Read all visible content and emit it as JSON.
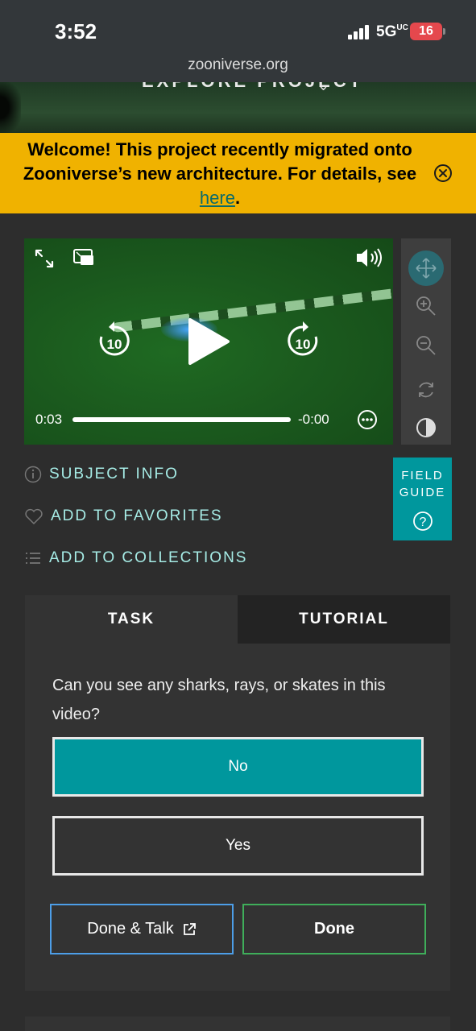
{
  "status_bar": {
    "time": "3:52",
    "network": "5G",
    "network_suffix": "UC",
    "battery": "16"
  },
  "browser": {
    "url": "zooniverse.org"
  },
  "hero": {
    "explore_label": "EXPLORE PROJECT"
  },
  "banner": {
    "text_before_link": "Welcome! This project recently migrated onto Zooniverse’s new architecture. For details, see ",
    "link_text": "here",
    "text_after_link": ".",
    "close_icon": "close-circle-icon"
  },
  "video": {
    "current_time": "0:03",
    "remaining_time": "-0:00",
    "skip_back_label": "10",
    "skip_forward_label": "10",
    "progress": 1.0,
    "icons": [
      "fullscreen-icon",
      "picture-in-picture-icon",
      "volume-icon",
      "skip-back-10-icon",
      "play-icon",
      "skip-forward-10-icon",
      "more-options-icon"
    ]
  },
  "tools": {
    "icons": [
      "move-icon",
      "zoom-in-icon",
      "zoom-out-icon",
      "rotate-icon",
      "invert-icon"
    ],
    "active": "move-icon",
    "accent": "#2a6a72"
  },
  "meta": {
    "subject_info": "SUBJECT INFO",
    "add_favorites": "ADD TO FAVORITES",
    "add_collections": "ADD TO COLLECTIONS"
  },
  "field_guide": {
    "line1": "FIELD",
    "line2": "GUIDE",
    "icon": "help-circle-icon"
  },
  "tabs": {
    "task": "TASK",
    "tutorial": "TUTORIAL"
  },
  "task": {
    "question": "Can you see any sharks, rays, or skates in this video?",
    "answers": [
      {
        "label": "No",
        "selected": true
      },
      {
        "label": "Yes",
        "selected": false
      }
    ],
    "done_talk": "Done & Talk",
    "done": "Done"
  },
  "colors": {
    "banner": "#f0b200",
    "teal": "#00979d",
    "link_teal": "#a6ece6",
    "done_border": "#3fae5a",
    "talk_border": "#4d9ee8"
  }
}
